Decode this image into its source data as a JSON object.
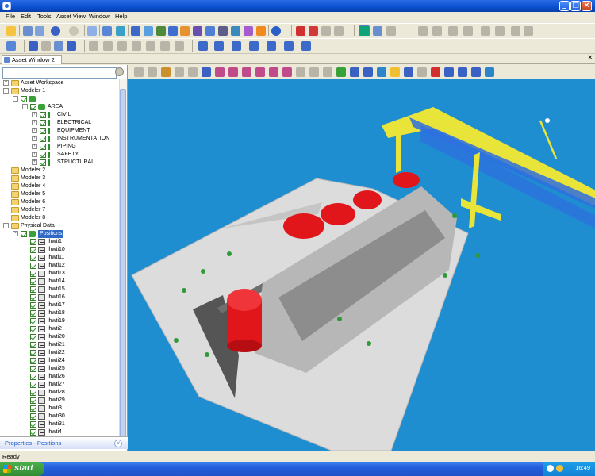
{
  "window": {
    "title": "",
    "controls": [
      "minimize",
      "maximize",
      "close"
    ]
  },
  "menubar": [
    "File",
    "Edit",
    "Tools",
    "Asset View",
    "Window",
    "Help"
  ],
  "tab": {
    "label": "Asset Window 2"
  },
  "search": {
    "value": ""
  },
  "tree": [
    {
      "label": "Asset Workspace",
      "level": 0,
      "expander": "+",
      "icon": "folder"
    },
    {
      "label": "Modeler 1",
      "level": 0,
      "expander": "-",
      "icon": "folder"
    },
    {
      "label": "",
      "level": 1,
      "expander": "-",
      "icon": "modeler-icon",
      "checked": true
    },
    {
      "label": "AREA",
      "level": 2,
      "expander": "-",
      "icon": "area-icon",
      "checked": true
    },
    {
      "label": "CIVIL",
      "level": 3,
      "expander": "+",
      "icon": "discipline-icon",
      "checked": true
    },
    {
      "label": "ELECTRICAL",
      "level": 3,
      "expander": "+",
      "icon": "discipline-icon",
      "checked": true
    },
    {
      "label": "EQUIPMENT",
      "level": 3,
      "expander": "+",
      "icon": "discipline-icon",
      "checked": true
    },
    {
      "label": "INSTRUMENTATION",
      "level": 3,
      "expander": "+",
      "icon": "discipline-icon",
      "checked": true
    },
    {
      "label": "PIPING",
      "level": 3,
      "expander": "+",
      "icon": "discipline-icon",
      "checked": true
    },
    {
      "label": "SAFETY",
      "level": 3,
      "expander": "+",
      "icon": "discipline-icon",
      "checked": true
    },
    {
      "label": "STRUCTURAL",
      "level": 3,
      "expander": "+",
      "icon": "discipline-icon",
      "checked": true
    },
    {
      "label": "Modeler 2",
      "level": 0,
      "icon": "folder"
    },
    {
      "label": "Modeler 3",
      "level": 0,
      "icon": "folder"
    },
    {
      "label": "Modeler 4",
      "level": 0,
      "icon": "folder"
    },
    {
      "label": "Modeler 5",
      "level": 0,
      "icon": "folder"
    },
    {
      "label": "Modeler 6",
      "level": 0,
      "icon": "folder"
    },
    {
      "label": "Modeler 7",
      "level": 0,
      "icon": "folder"
    },
    {
      "label": "Modeler 8",
      "level": 0,
      "icon": "folder"
    },
    {
      "label": "Physical Data",
      "level": 0,
      "expander": "-",
      "icon": "folder"
    },
    {
      "label": "Positions",
      "level": 1,
      "expander": "-",
      "icon": "positions-icon",
      "checked": true,
      "selected": true
    },
    {
      "label": "lhwti1",
      "level": 2,
      "icon": "position-icon",
      "checked": true
    },
    {
      "label": "lhwti10",
      "level": 2,
      "icon": "position-icon",
      "checked": true
    },
    {
      "label": "lhwti11",
      "level": 2,
      "icon": "position-icon",
      "checked": true
    },
    {
      "label": "lhwti12",
      "level": 2,
      "icon": "position-icon",
      "checked": true
    },
    {
      "label": "lhwti13",
      "level": 2,
      "icon": "position-icon",
      "checked": true
    },
    {
      "label": "lhwti14",
      "level": 2,
      "icon": "position-icon",
      "checked": true
    },
    {
      "label": "lhwti15",
      "level": 2,
      "icon": "position-icon",
      "checked": true
    },
    {
      "label": "lhwti16",
      "level": 2,
      "icon": "position-icon",
      "checked": true
    },
    {
      "label": "lhwti17",
      "level": 2,
      "icon": "position-icon",
      "checked": true
    },
    {
      "label": "lhwti18",
      "level": 2,
      "icon": "position-icon",
      "checked": true
    },
    {
      "label": "lhwti19",
      "level": 2,
      "icon": "position-icon",
      "checked": true
    },
    {
      "label": "lhwti2",
      "level": 2,
      "icon": "position-icon",
      "checked": true
    },
    {
      "label": "lhwti20",
      "level": 2,
      "icon": "position-icon",
      "checked": true
    },
    {
      "label": "lhwti21",
      "level": 2,
      "icon": "position-icon",
      "checked": true
    },
    {
      "label": "lhwti22",
      "level": 2,
      "icon": "position-icon",
      "checked": true
    },
    {
      "label": "lhwti24",
      "level": 2,
      "icon": "position-icon",
      "checked": true
    },
    {
      "label": "lhwti25",
      "level": 2,
      "icon": "position-icon",
      "checked": true
    },
    {
      "label": "lhwti26",
      "level": 2,
      "icon": "position-icon",
      "checked": true
    },
    {
      "label": "lhwti27",
      "level": 2,
      "icon": "position-icon",
      "checked": true
    },
    {
      "label": "lhwti28",
      "level": 2,
      "icon": "position-icon",
      "checked": true
    },
    {
      "label": "lhwti29",
      "level": 2,
      "icon": "position-icon",
      "checked": true
    },
    {
      "label": "lhwti3",
      "level": 2,
      "icon": "position-icon",
      "checked": true
    },
    {
      "label": "lhwti30",
      "level": 2,
      "icon": "position-icon",
      "checked": true
    },
    {
      "label": "lhwti31",
      "level": 2,
      "icon": "position-icon",
      "checked": true
    },
    {
      "label": "lhwti4",
      "level": 2,
      "icon": "position-icon",
      "checked": true
    }
  ],
  "properties": {
    "label": "Properties - Positions"
  },
  "status": {
    "text": "Ready"
  },
  "taskbar": {
    "start_label": "start",
    "clock": "16:49"
  },
  "colors": {
    "viewport_bg": "#1f8ed0",
    "floor": "#dcdcdc",
    "vessel_red": "#e0161b",
    "steel_yellow": "#f3ef1a",
    "pipe_blue": "#2f6fe0",
    "scan_marker_green": "#2f9a3a"
  }
}
